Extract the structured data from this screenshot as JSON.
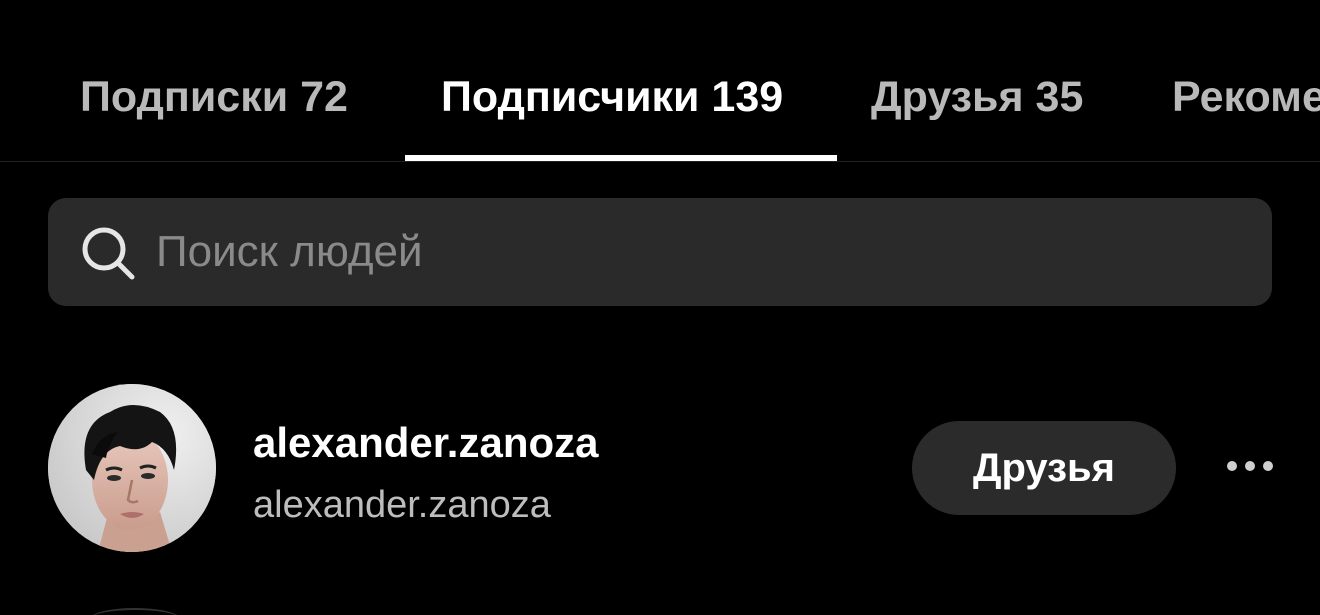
{
  "tabs": [
    {
      "label": "Подписки 72",
      "active": false
    },
    {
      "label": "Подписчики 139",
      "active": true
    },
    {
      "label": "Друзья 35",
      "active": false
    },
    {
      "label": "Рекомендации",
      "active": false
    }
  ],
  "search": {
    "placeholder": "Поиск людей",
    "value": "",
    "icon": "search-icon"
  },
  "list": {
    "items": [
      {
        "display_name": "alexander.zanoza",
        "username": "alexander.zanoza",
        "button_label": "Друзья",
        "more_icon": "more-horizontal-icon"
      }
    ]
  },
  "colors": {
    "background": "#000000",
    "tab_inactive": "#b9b9b9",
    "tab_active": "#ffffff",
    "search_bg": "#2a2a2a",
    "button_bg": "#2b2b2b"
  }
}
